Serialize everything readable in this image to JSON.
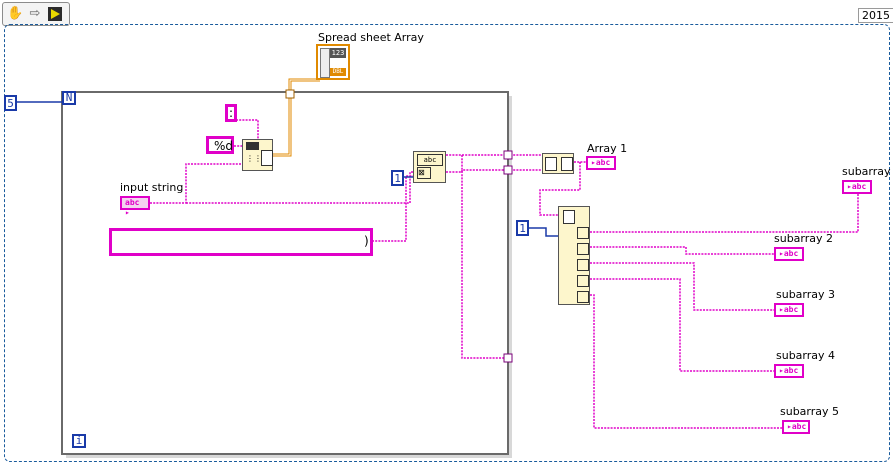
{
  "toolbar": {
    "tools": [
      "hand-tool",
      "arrow-tool",
      "run-tool"
    ]
  },
  "version_label": "2015",
  "for_loop": {
    "count_label": "N",
    "count_value": "5",
    "iteration_label": "i"
  },
  "controls": {
    "input_string_label": "input string",
    "input_string_type": "abc",
    "format_string": "%d",
    "delimiter_string": ":",
    "long_string_value": ")"
  },
  "constants": {
    "index_const_1": "1",
    "index_const_2": "1"
  },
  "spreadsheet_array": {
    "label": "Spread sheet Array",
    "type_top": "123",
    "type_bottom": "DBL"
  },
  "indicators": [
    {
      "label": "Array 1",
      "type": "abc"
    },
    {
      "label": "subarray",
      "type": "abc"
    },
    {
      "label": "subarray 2",
      "type": "abc"
    },
    {
      "label": "subarray 3",
      "type": "abc"
    },
    {
      "label": "subarray 4",
      "type": "abc"
    },
    {
      "label": "subarray 5",
      "type": "abc"
    }
  ],
  "colors": {
    "string_wire": "#e000c8",
    "numeric_wire": "#1a3aa8",
    "dbl_wire": "#e08a00",
    "diagram_border": "#1a5b9c"
  }
}
